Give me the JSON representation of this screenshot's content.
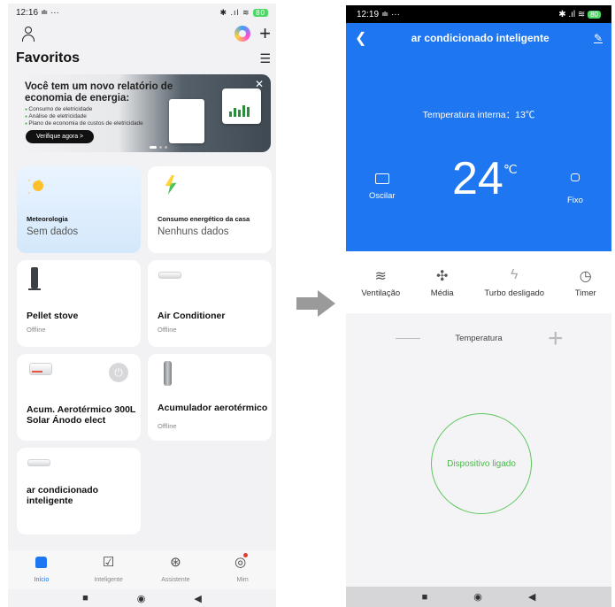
{
  "left": {
    "status": {
      "time": "12:16",
      "notif": "≐ ···",
      "right": "✱ .ıl ≋",
      "battery": "80"
    },
    "favorites_title": "Favoritos",
    "banner": {
      "title": "Você tem um novo relatório de economia de energia:",
      "items": [
        "Consumo de eletricidade",
        "Análise de eletricidade",
        "Plano de economia de custos de eletricidade"
      ],
      "cta": "Verifique agora >"
    },
    "cards": [
      {
        "name": "Meteorologia",
        "sub": "Sem dados",
        "icon": "sun-icon"
      },
      {
        "name": "Consumo energético da casa",
        "sub": "Nenhuns dados",
        "icon": "energy-icon"
      },
      {
        "name": "Pellet stove",
        "sub": "Offline",
        "icon": "stove-icon"
      },
      {
        "name": "Air Conditioner",
        "sub": "Offline",
        "icon": "ac-icon"
      },
      {
        "name": "Acum. Aerotérmico 300L Solar Ánodo elect",
        "sub": "",
        "icon": "heater-icon"
      },
      {
        "name": "Acumulador aerotérmico",
        "sub": "Offline",
        "icon": "tank-icon"
      },
      {
        "name": "ar condicionado inteligente",
        "sub": "",
        "icon": "ac-icon"
      }
    ],
    "nav": [
      {
        "label": "Início",
        "icon": "home-icon"
      },
      {
        "label": "Inteligente",
        "icon": "smart-icon"
      },
      {
        "label": "Assistente",
        "icon": "assistant-icon"
      },
      {
        "label": "Mim",
        "icon": "profile-icon"
      }
    ],
    "sysnav": {
      "recent": "■",
      "home": "◉",
      "back": "◀"
    }
  },
  "right": {
    "status": {
      "time": "12:19",
      "notif": "≐ ···",
      "right": "✱ .ıl ≋",
      "battery": "80"
    },
    "title": "ar condicionado inteligente",
    "indoor_temp": "Temperatura interna：13℃",
    "set_temp": "24",
    "unit": "℃",
    "oscillate_label": "Oscilar",
    "fixed_label": "Fixo",
    "modes": [
      {
        "label": "Ventilação",
        "icon": "wind-icon"
      },
      {
        "label": "Média",
        "icon": "fan-icon"
      },
      {
        "label": "Turbo desligado",
        "icon": "turbo-icon"
      },
      {
        "label": "Timer",
        "icon": "timer-icon"
      }
    ],
    "temp_label": "Temperatura",
    "power_status": "Dispositivo ligado",
    "sysnav": {
      "recent": "■",
      "home": "◉",
      "back": "◀"
    }
  },
  "colors": {
    "accent": "#1e76f0",
    "online": "#4cb84c",
    "battery": "#4cd964"
  }
}
